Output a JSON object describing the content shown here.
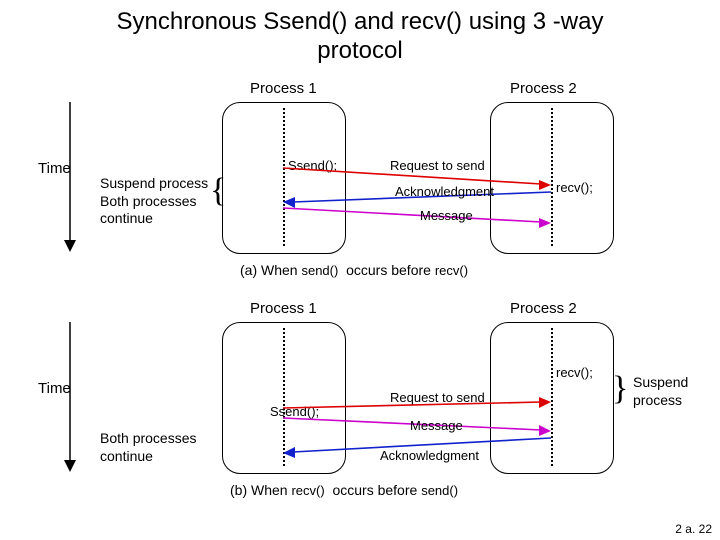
{
  "title_line1": "Synchronous Ssend() and recv() using 3 -way",
  "title_line2": "protocol",
  "labels": {
    "process1": "Process 1",
    "process2": "Process 2",
    "time": "Time",
    "ssend": "Ssend();",
    "recv": "recv();",
    "request_to_send": "Request to send",
    "acknowledgment": "Acknowledgment",
    "message": "Message",
    "suspend_process": "Suspend process",
    "both_continue": "Both processes continue",
    "suspend_side_a_full": "Suspend\nprocess\nBoth processes\ncontinue"
  },
  "captions": {
    "a_prefix": "(a) When ",
    "a_mid": "send()",
    "a_suffix": " occurs before ",
    "a_end": "recv()",
    "b_prefix": "(b) When ",
    "b_mid": "recv()",
    "b_suffix": " occurs before ",
    "b_end": "send()"
  },
  "pagefoot": "2 a. 22",
  "chart_data": [
    {
      "type": "diagram",
      "title": "(a) When send() occurs before recv()",
      "actors": [
        "Process 1",
        "Process 2"
      ],
      "events": [
        {
          "at": "Process 1",
          "call": "Ssend();",
          "note_left": "Suspend process"
        },
        {
          "arrow": "Request to send",
          "from": "Process 1",
          "to": "Process 2",
          "color": "red"
        },
        {
          "at": "Process 2",
          "call": "recv();"
        },
        {
          "arrow": "Acknowledgment",
          "from": "Process 2",
          "to": "Process 1",
          "color": "blue"
        },
        {
          "arrow": "Message",
          "from": "Process 1",
          "to": "Process 2",
          "color": "magenta"
        },
        {
          "note_left": "Both processes continue"
        }
      ]
    },
    {
      "type": "diagram",
      "title": "(b) When recv() occurs before send()",
      "actors": [
        "Process 1",
        "Process 2"
      ],
      "events": [
        {
          "at": "Process 2",
          "call": "recv();",
          "note_right": "Suspend process"
        },
        {
          "at": "Process 1",
          "call": "Ssend();"
        },
        {
          "arrow": "Request to send",
          "from": "Process 1",
          "to": "Process 2",
          "color": "red"
        },
        {
          "arrow": "Message",
          "from": "Process 1",
          "to": "Process 2",
          "color": "magenta"
        },
        {
          "arrow": "Acknowledgment",
          "from": "Process 2",
          "to": "Process 1",
          "color": "blue"
        },
        {
          "note_left": "Both processes continue"
        }
      ]
    }
  ]
}
